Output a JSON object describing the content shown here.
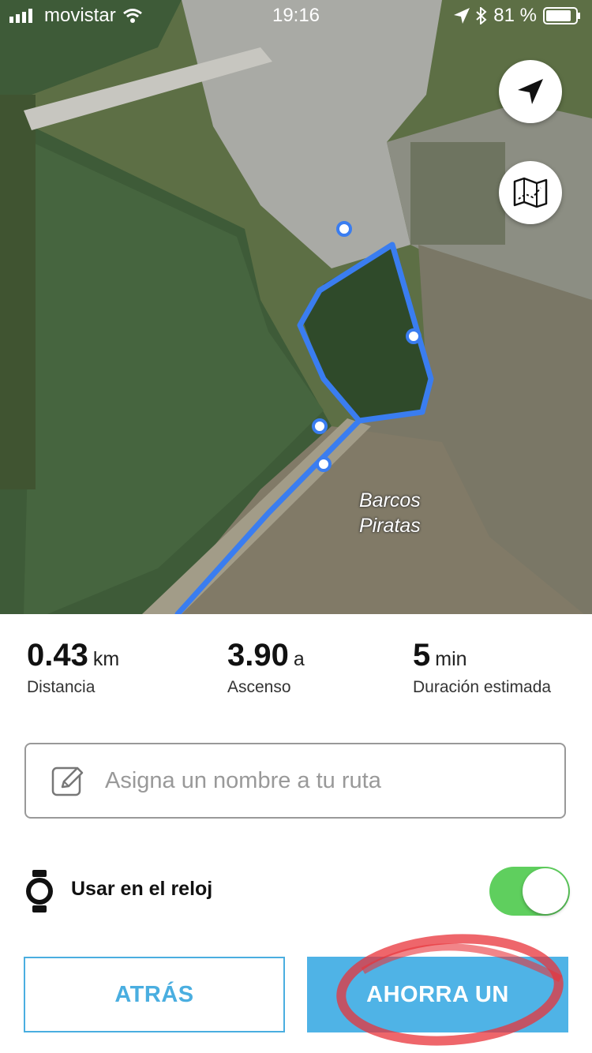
{
  "status_bar": {
    "carrier": "movistar",
    "time": "19:16",
    "battery": "81 %"
  },
  "map": {
    "place_label_line1": "Barcos",
    "place_label_line2": "Piratas",
    "route_color": "#3a7df0",
    "locate_icon": "navigation-arrow-icon",
    "layers_icon": "map-layers-icon"
  },
  "stats": [
    {
      "value": "0.43",
      "unit": "km",
      "label": "Distancia"
    },
    {
      "value": "3.90",
      "unit": "a",
      "label": "Ascenso"
    },
    {
      "value": "5",
      "unit": "min",
      "label": "Duración estimada"
    }
  ],
  "route_name": {
    "value": "",
    "placeholder": "Asigna un nombre a tu ruta"
  },
  "watch": {
    "label": "Usar en el reloj",
    "enabled": true
  },
  "buttons": {
    "back": "ATRÁS",
    "save": "AHORRA UN"
  },
  "colors": {
    "accent": "#4fb3e6",
    "toggle_on": "#5fcf5e",
    "annotation": "#e8333a"
  }
}
